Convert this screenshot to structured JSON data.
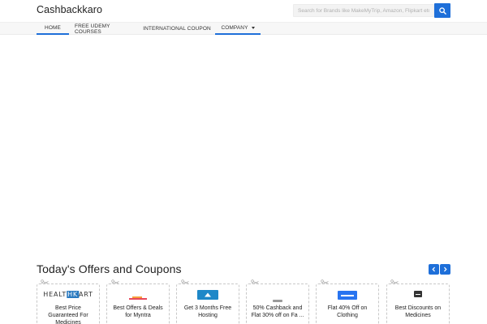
{
  "header": {
    "brand": "Cashbackkaro",
    "search_placeholder": "Search for Brands like MakeMyTrip, Amazon, Flipkart etc.",
    "search_icon": "search-icon"
  },
  "nav": {
    "items": [
      {
        "label": "HOME"
      },
      {
        "label": "FREE UDEMY COURSES"
      },
      {
        "label": "INTERNATIONAL COUPON"
      },
      {
        "label": "COMPANY"
      }
    ]
  },
  "offers": {
    "title": "Today's Offers and Coupons",
    "cards": [
      {
        "logo": "HEALTH HK ART",
        "text": "Best Price Guaranteed For Medicines"
      },
      {
        "logo": "myntra",
        "text": "Best Offers & Deals for Myntra"
      },
      {
        "logo": "hostinger",
        "text": "Get 3 Months Free Hosting"
      },
      {
        "logo": "ajio",
        "text": "50% Cashback and Flat 30% off on Fa ..."
      },
      {
        "logo": "Flipkart",
        "text": "Flat 40% Off on Clothing"
      },
      {
        "logo": "1mg",
        "text": "Best Discounts on Medicines"
      }
    ]
  },
  "colors": {
    "accent": "#1e6fd9",
    "nav_bg": "#f7f7f7"
  }
}
